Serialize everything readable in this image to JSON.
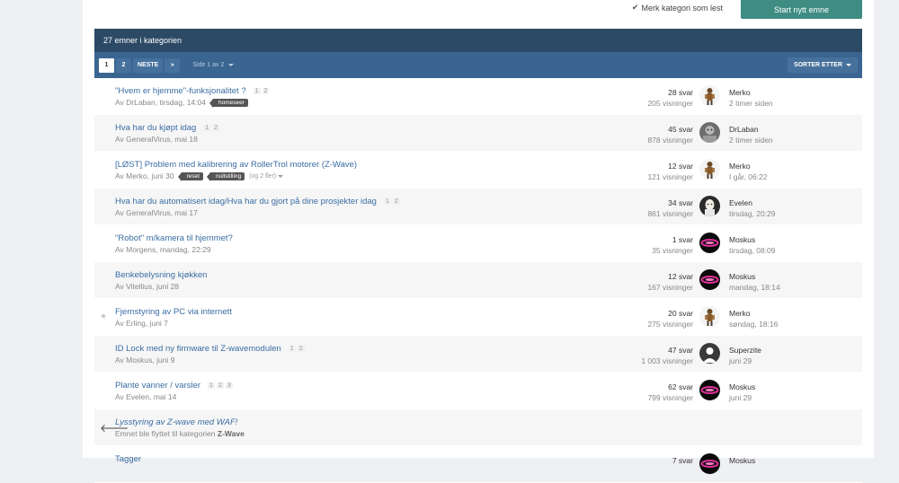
{
  "actions": {
    "mark_read": "Merk kategori som lest",
    "start_topic": "Start nytt emne"
  },
  "header": {
    "count_label": "27 emner i kategorien"
  },
  "pager": {
    "pages": [
      "1",
      "2"
    ],
    "next": "NESTE",
    "last_icon": "»",
    "info": "Side 1 av 2",
    "sort": "SORTER ETTER"
  },
  "rows": [
    {
      "title": "\"Hvem er hjemme\"-funksjonalitet ?",
      "mini_pages": [
        "1",
        "2"
      ],
      "author": "Av DrLaban, tirsdag, 14:04",
      "tags": [
        "homeseer"
      ],
      "more": "",
      "replies": "28 svar",
      "views": "205 visninger",
      "last_user": "Merko",
      "last_time": "2 timer siden",
      "avatar": "figure-avatar"
    },
    {
      "title": "Hva har du kjøpt idag",
      "mini_pages": [
        "1",
        "2"
      ],
      "author": "Av GeneralVirus, mai 18",
      "tags": [],
      "more": "",
      "replies": "45 svar",
      "views": "878 visninger",
      "last_user": "DrLaban",
      "last_time": "2 timer siden",
      "avatar": "photo-avatar"
    },
    {
      "title": "[LØST] Problem med kalibrering av RollerTrol motorer (Z-Wave)",
      "mini_pages": [],
      "author": "Av Merko, juni 30",
      "tags": [
        "reset",
        "nullstilling"
      ],
      "more": "(og 2 fler)",
      "replies": "12 svar",
      "views": "121 visninger",
      "last_user": "Merko",
      "last_time": "I går, 06:22",
      "avatar": "figure-avatar"
    },
    {
      "title": "Hva har du automatisert idag/Hva har du gjort på dine prosjekter idag",
      "mini_pages": [
        "1",
        "2"
      ],
      "author": "Av GeneralVirus, mai 17",
      "tags": [],
      "more": "",
      "replies": "34 svar",
      "views": "861 visninger",
      "last_user": "Evelen",
      "last_time": "tirsdag, 20:29",
      "avatar": "portrait-avatar"
    },
    {
      "title": "\"Robot\" m/kamera til hjemmet?",
      "mini_pages": [],
      "author": "Av Morgens, mandag, 22:29",
      "tags": [],
      "more": "",
      "replies": "1 svar",
      "views": "35 visninger",
      "last_user": "Moskus",
      "last_time": "tirsdag, 08:09",
      "avatar": "ring-avatar"
    },
    {
      "title": "Benkebelysning kjøkken",
      "mini_pages": [],
      "author": "Av Vitellius, juni 28",
      "tags": [],
      "more": "",
      "replies": "12 svar",
      "views": "167 visninger",
      "last_user": "Moskus",
      "last_time": "mandag, 18:14",
      "avatar": "ring-avatar"
    },
    {
      "title": "Fjernstyring av PC via internett",
      "mini_pages": [],
      "author": "Av Erling, juni 7",
      "tags": [],
      "more": "",
      "replies": "20 svar",
      "views": "275 visninger",
      "last_user": "Merko",
      "last_time": "søndag, 18:16",
      "avatar": "figure-avatar",
      "star": true
    },
    {
      "title": "ID Lock med ny firmware til Z-wavemodulen",
      "mini_pages": [
        "1",
        "2"
      ],
      "author": "Av Moskus, juni 9",
      "tags": [],
      "more": "",
      "replies": "47 svar",
      "views": "1 003 visninger",
      "last_user": "Superzite",
      "last_time": "juni 29",
      "avatar": "silhouette-avatar"
    },
    {
      "title": "Plante vanner / varsler",
      "mini_pages": [
        "1",
        "2",
        "3"
      ],
      "author": "Av Evelen, mai 14",
      "tags": [],
      "more": "",
      "replies": "62 svar",
      "views": "799 visninger",
      "last_user": "Moskus",
      "last_time": "juni 29",
      "avatar": "ring-avatar"
    }
  ],
  "moved": {
    "title": "Lysstyring av Z-wave med WAF!",
    "note": "Emnet ble flyttet til kategorien",
    "category": "Z-Wave"
  },
  "partial_row": {
    "title": "Tagger",
    "replies": "7 svar",
    "last_user": "Moskus"
  },
  "colors": {
    "header": "#2c4a66",
    "pager": "#3a6590",
    "start_button": "#3f8c82",
    "link": "#3a6da3"
  }
}
